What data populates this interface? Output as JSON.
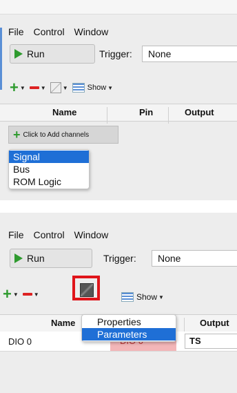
{
  "menu": [
    "File",
    "Control",
    "Window"
  ],
  "toolbar": {
    "run": "Run",
    "trigger_label": "Trigger:",
    "trigger_value": "None",
    "show": "Show"
  },
  "columns": {
    "name": "Name",
    "pin": "Pin",
    "output": "Output"
  },
  "panel1": {
    "add_channels": "Click to Add channels",
    "add_menu": [
      "Signal",
      "Bus",
      "ROM Logic"
    ],
    "selected_index": 0
  },
  "panel2": {
    "row": {
      "name": "DIO 0",
      "pin": "DIO 0",
      "output": "TS"
    },
    "context_menu": [
      "Properties",
      "Parameters"
    ],
    "selected_index": 1
  },
  "colors": {
    "selection": "#1f6fd6",
    "highlight_box": "#e0141a",
    "run_icon": "#2e9a2e"
  }
}
